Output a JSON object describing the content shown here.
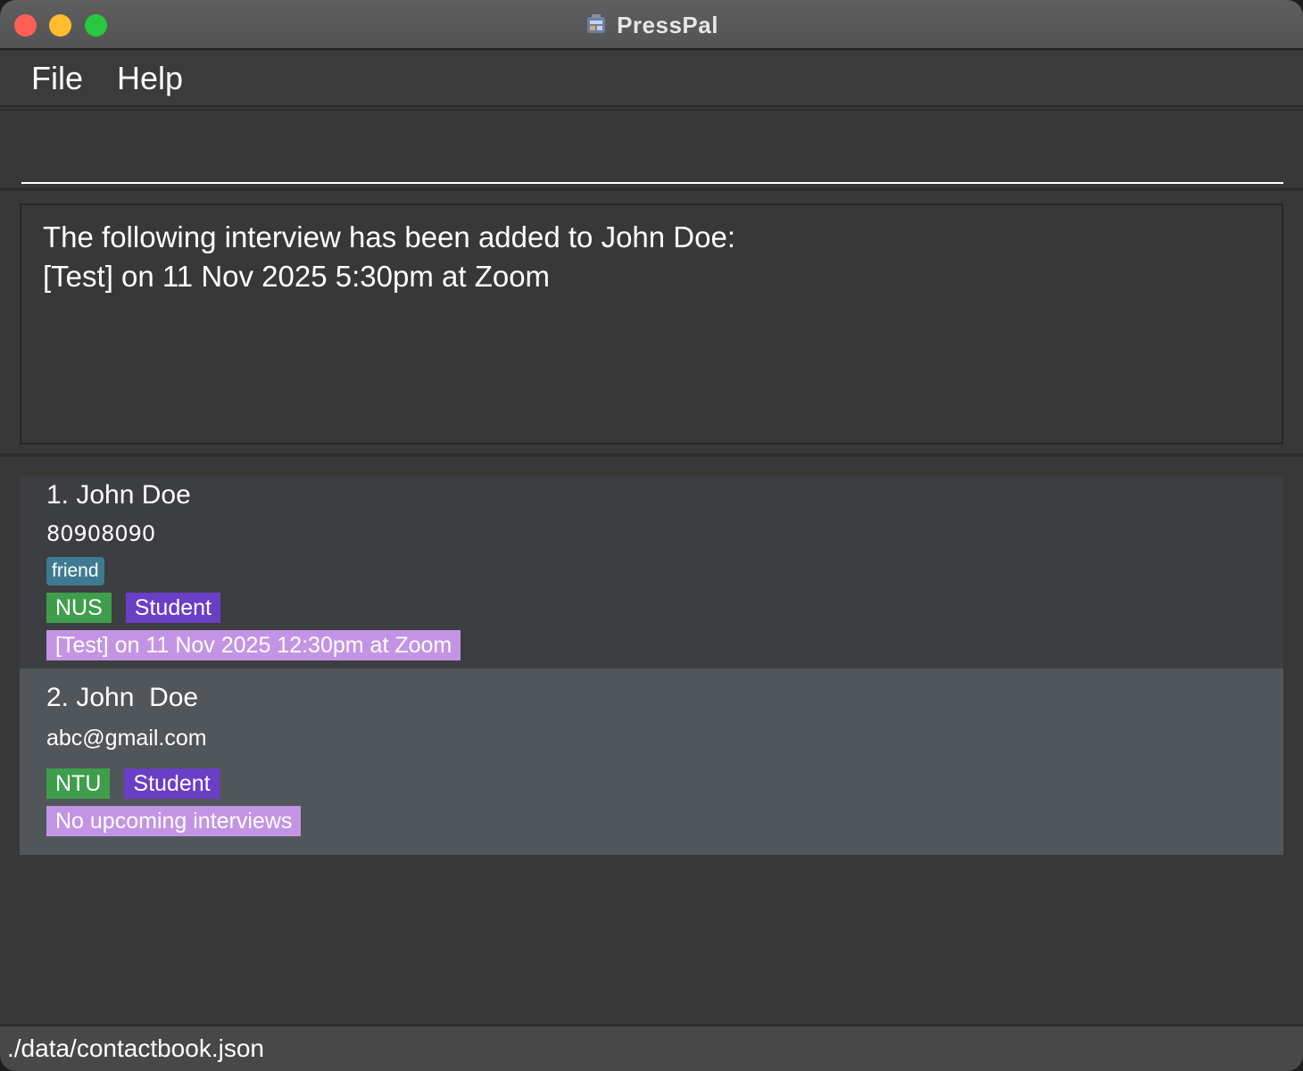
{
  "window": {
    "title": "PressPal"
  },
  "menu": {
    "items": [
      {
        "label": "File"
      },
      {
        "label": "Help"
      }
    ]
  },
  "command": {
    "value": ""
  },
  "result": {
    "lines": [
      "The following interview has been added to John Doe:",
      "[Test] on 11 Nov 2025 5:30pm at Zoom"
    ]
  },
  "persons": [
    {
      "name": "1. John Doe",
      "detail": "80908090",
      "tags": [
        "friend"
      ],
      "labels": [
        "NUS",
        "Student"
      ],
      "interview": "[Test] on 11 Nov 2025 12:30pm at Zoom"
    },
    {
      "name": "2. John  Doe",
      "detail": "abc@gmail.com",
      "labels": [
        "NTU",
        "Student"
      ],
      "interview": "No upcoming interviews"
    }
  ],
  "status": {
    "path": "./data/contactbook.json"
  },
  "colors": {
    "friend_tag": "#3e7b91",
    "school_tag": "#3e9e4b",
    "role_tag": "#6a3ec5",
    "interview_tag": "#c394e4",
    "traffic_close": "#ff5f57",
    "traffic_minimize": "#febc2e",
    "traffic_zoom": "#28c840"
  },
  "icons": {
    "app": "presspal-app-icon"
  }
}
